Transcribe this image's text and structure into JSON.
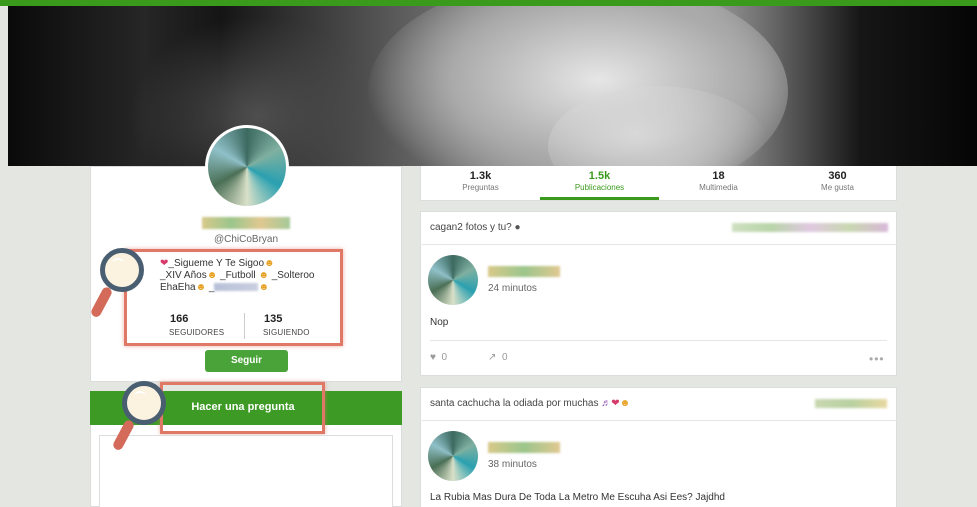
{
  "profile": {
    "handle": "@ChiCoBryan",
    "bio_line1": "_Sigueme Y Te Sigoo",
    "bio_line2a": "_XIV Años",
    "bio_line2b": "_Futboll",
    "bio_line2c": "_Solteroo",
    "bio_line3": "EhaEha",
    "bio_line3b": "_",
    "followers_count": "166",
    "followers_label": "SEGUIDORES",
    "following_count": "135",
    "following_label": "SIGUIENDO",
    "follow_button": "Seguir",
    "ask_button": "Hacer una pregunta"
  },
  "stats": [
    {
      "count": "1.3k",
      "label": "Preguntas"
    },
    {
      "count": "1.5k",
      "label": "Publicaciones"
    },
    {
      "count": "18",
      "label": "Multimedia"
    },
    {
      "count": "360",
      "label": "Me gusta"
    }
  ],
  "active_stat": "Publicaciones",
  "posts": [
    {
      "question": "cagan2 fotos y tu?",
      "time": "24 minutos",
      "answer": "Nop",
      "likes": "0",
      "shares": "0"
    },
    {
      "question": "santa cachucha la odiada por muchas",
      "time": "38 minutos",
      "answer": "La Rubia Mas Dura De Toda La Metro Me Escuha Asi Ees? Jajdhd"
    }
  ],
  "colors": {
    "accent": "#3a9a1c",
    "highlight": "#e07868",
    "magnifier_frame": "#4a5e72"
  },
  "icons": {
    "heart": "heart-icon",
    "emoji": "emoji-icon",
    "like": "heart-outline-icon",
    "share": "share-arrow-icon",
    "more": "more-dots-icon",
    "magnifier": "magnifier-icon"
  }
}
